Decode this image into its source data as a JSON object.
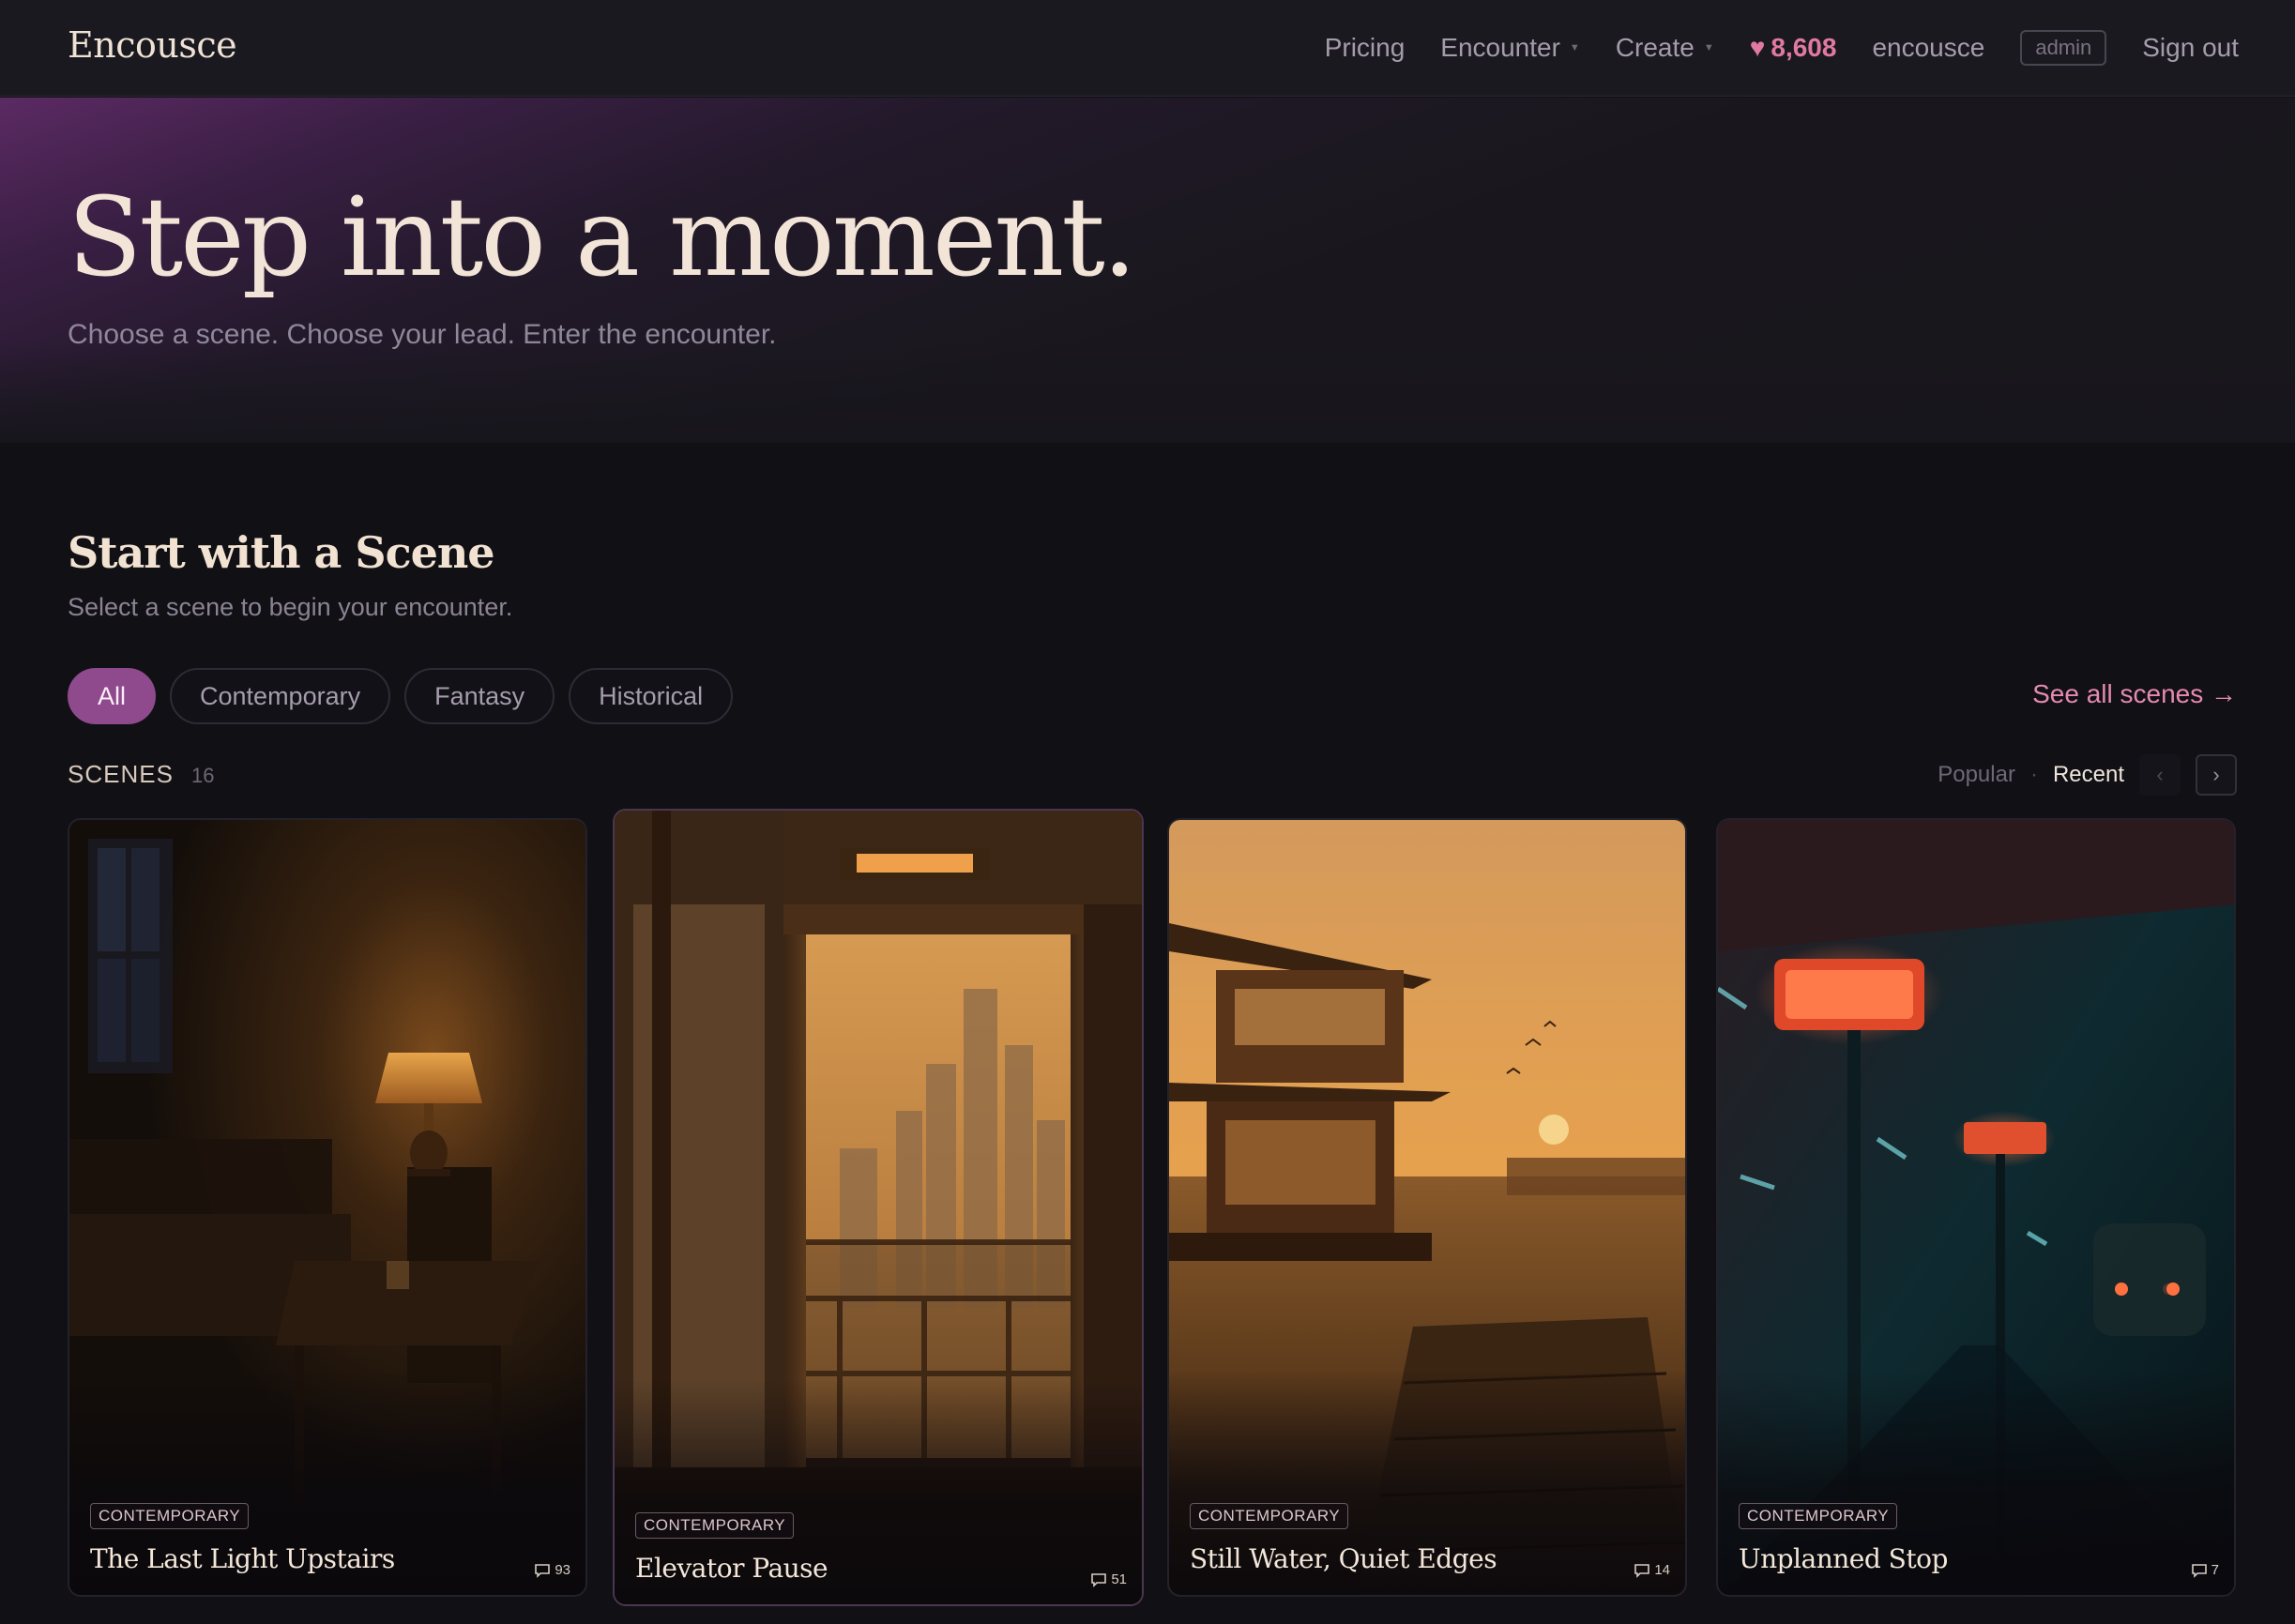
{
  "nav": {
    "brand": "Encousce",
    "pricing": "Pricing",
    "encounter": "Encounter",
    "create": "Create",
    "hearts": "8,608",
    "username": "encousce",
    "role_badge": "admin",
    "sign_out": "Sign out"
  },
  "hero": {
    "title": "Step into a moment.",
    "subtitle": "Choose a scene. Choose your lead. Enter the encounter."
  },
  "section": {
    "title": "Start with a Scene",
    "subtitle": "Select a scene to begin your encounter.",
    "filters": [
      "All",
      "Contemporary",
      "Fantasy",
      "Historical"
    ],
    "active_filter": "All",
    "see_all": "See all scenes →",
    "scenes_label": "SCENES",
    "scenes_count": "16",
    "sort_popular": "Popular",
    "sort_separator": "·",
    "sort_recent": "Recent",
    "active_sort": "Recent",
    "prev_arrow": "‹",
    "next_arrow": "›"
  },
  "cards": [
    {
      "tag": "CONTEMPORARY",
      "title": "The Last Light Upstairs",
      "comments": "93"
    },
    {
      "tag": "CONTEMPORARY",
      "title": "Elevator Pause",
      "comments": "51"
    },
    {
      "tag": "CONTEMPORARY",
      "title": "Still Water, Quiet Edges",
      "comments": "14"
    },
    {
      "tag": "CONTEMPORARY",
      "title": "Unplanned Stop",
      "comments": "7"
    }
  ],
  "colors": {
    "background": "#111015",
    "accent": "#8e4a8c",
    "link": "#e58ab0",
    "heart": "#e07aa0"
  }
}
